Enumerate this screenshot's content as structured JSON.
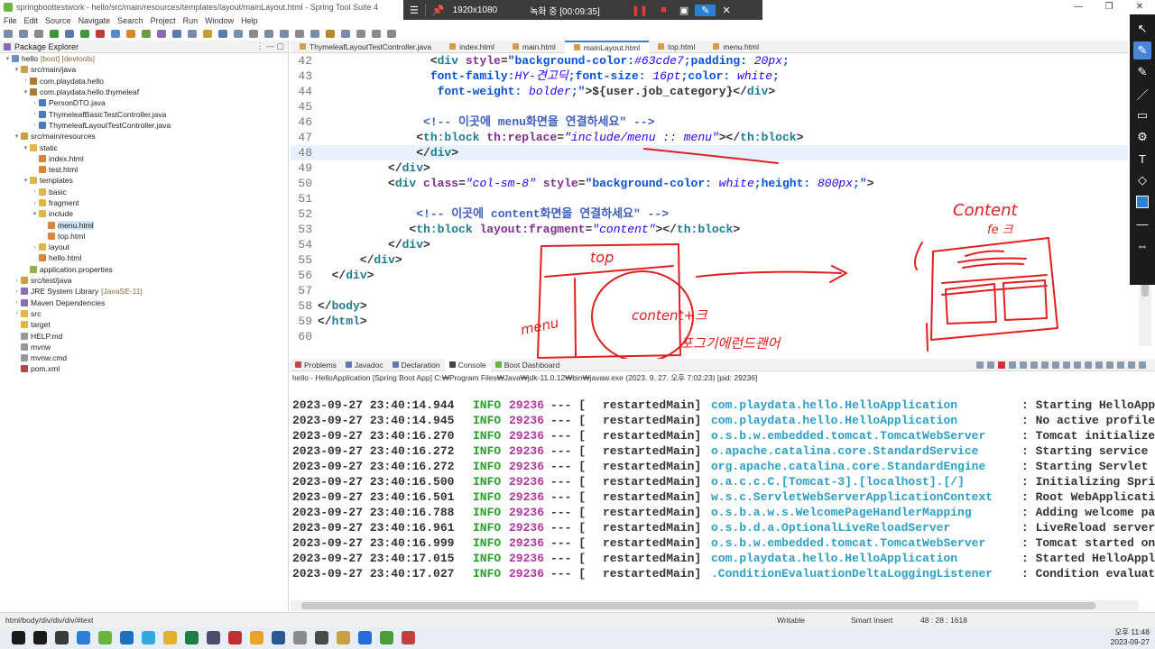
{
  "window": {
    "title": "springboottestwork - hello/src/main/resources/templates/layout/mainLayout.html - Spring Tool Suite 4",
    "controls": [
      "—",
      "❐",
      "✕"
    ]
  },
  "recorder": {
    "resolution": "1920x1080",
    "status": "녹화 중 [00:09:35]"
  },
  "menu": [
    "File",
    "Edit",
    "Source",
    "Navigate",
    "Search",
    "Project",
    "Run",
    "Window",
    "Help"
  ],
  "package_explorer": {
    "title": "Package Explorer",
    "items": [
      {
        "depth": 0,
        "arrow": "▾",
        "label": "hello",
        "decor": "[boot] [devtools]",
        "icon_color": "#6b8fc4",
        "selected": false
      },
      {
        "depth": 1,
        "arrow": "▾",
        "label": "src/main/java",
        "decor": "",
        "icon_color": "#c9a04a",
        "selected": false
      },
      {
        "depth": 2,
        "arrow": "›",
        "label": "com.playdata.hello",
        "decor": "",
        "icon_color": "#a97c2e",
        "selected": false
      },
      {
        "depth": 2,
        "arrow": "▾",
        "label": "com.playdata.hello.thymeleaf",
        "decor": "",
        "icon_color": "#a97c2e",
        "selected": false
      },
      {
        "depth": 3,
        "arrow": "›",
        "label": "PersonDTO.java",
        "decor": "",
        "icon_color": "#4a7bc1",
        "selected": false
      },
      {
        "depth": 3,
        "arrow": "›",
        "label": "ThymeleafBasicTestController.java",
        "decor": "",
        "icon_color": "#4a7bc1",
        "selected": false
      },
      {
        "depth": 3,
        "arrow": "›",
        "label": "ThymeleafLayoutTestController.java",
        "decor": "",
        "icon_color": "#4a7bc1",
        "selected": false
      },
      {
        "depth": 1,
        "arrow": "▾",
        "label": "src/main/resources",
        "decor": "",
        "icon_color": "#c9a04a",
        "selected": false
      },
      {
        "depth": 2,
        "arrow": "▾",
        "label": "static",
        "decor": "",
        "icon_color": "#e0b64a",
        "selected": false
      },
      {
        "depth": 3,
        "arrow": "",
        "label": "index.html",
        "decor": "",
        "icon_color": "#d9863a",
        "selected": false
      },
      {
        "depth": 3,
        "arrow": "",
        "label": "test.html",
        "decor": "",
        "icon_color": "#d9863a",
        "selected": false
      },
      {
        "depth": 2,
        "arrow": "▾",
        "label": "templates",
        "decor": "",
        "icon_color": "#e0b64a",
        "selected": false
      },
      {
        "depth": 3,
        "arrow": "›",
        "label": "basic",
        "decor": "",
        "icon_color": "#e0b64a",
        "selected": false
      },
      {
        "depth": 3,
        "arrow": "›",
        "label": "fragment",
        "decor": "",
        "icon_color": "#e0b64a",
        "selected": false
      },
      {
        "depth": 3,
        "arrow": "▾",
        "label": "include",
        "decor": "",
        "icon_color": "#e0b64a",
        "selected": false
      },
      {
        "depth": 4,
        "arrow": "",
        "label": "menu.html",
        "decor": "",
        "icon_color": "#d9863a",
        "selected": true
      },
      {
        "depth": 4,
        "arrow": "",
        "label": "top.html",
        "decor": "",
        "icon_color": "#d9863a",
        "selected": false
      },
      {
        "depth": 3,
        "arrow": "›",
        "label": "layout",
        "decor": "",
        "icon_color": "#e0b64a",
        "selected": false
      },
      {
        "depth": 3,
        "arrow": "",
        "label": "hello.html",
        "decor": "",
        "icon_color": "#d9863a",
        "selected": false
      },
      {
        "depth": 2,
        "arrow": "",
        "label": "application.properties",
        "decor": "",
        "icon_color": "#8cb54a",
        "selected": false
      },
      {
        "depth": 1,
        "arrow": "›",
        "label": "src/test/java",
        "decor": "",
        "icon_color": "#c9a04a",
        "selected": false
      },
      {
        "depth": 1,
        "arrow": "›",
        "label": "JRE System Library",
        "decor": "[JavaSE-11]",
        "icon_color": "#8b6db3",
        "selected": false
      },
      {
        "depth": 1,
        "arrow": "›",
        "label": "Maven Dependencies",
        "decor": "",
        "icon_color": "#8b6db3",
        "selected": false
      },
      {
        "depth": 1,
        "arrow": "›",
        "label": "src",
        "decor": "",
        "icon_color": "#e0b64a",
        "selected": false
      },
      {
        "depth": 1,
        "arrow": "",
        "label": "target",
        "decor": "",
        "icon_color": "#e0b64a",
        "selected": false
      },
      {
        "depth": 1,
        "arrow": "",
        "label": "HELP.md",
        "decor": "",
        "icon_color": "#999999",
        "selected": false
      },
      {
        "depth": 1,
        "arrow": "",
        "label": "mvnw",
        "decor": "",
        "icon_color": "#999999",
        "selected": false
      },
      {
        "depth": 1,
        "arrow": "",
        "label": "mvnw.cmd",
        "decor": "",
        "icon_color": "#999999",
        "selected": false
      },
      {
        "depth": 1,
        "arrow": "",
        "label": "pom.xml",
        "decor": "",
        "icon_color": "#b04a4a",
        "selected": false
      }
    ]
  },
  "editor_tabs": [
    {
      "label": "ThymeleafLayoutTestController.java",
      "active": false
    },
    {
      "label": "index.html",
      "active": false
    },
    {
      "label": "main.html",
      "active": false
    },
    {
      "label": "mainLayout.html",
      "active": true
    },
    {
      "label": "top.html",
      "active": false
    },
    {
      "label": "menu.html",
      "active": false
    }
  ],
  "code_lines": [
    {
      "n": "42",
      "current": false,
      "parts": [
        [
          "",
          "                <"
        ],
        [
          "tg",
          "div"
        ],
        [
          "",
          " "
        ],
        [
          "at",
          "style"
        ],
        [
          "",
          "="
        ],
        [
          "sk",
          "\"background-color:"
        ],
        [
          "sv",
          "#63cde7"
        ],
        [
          "sk",
          ";padding: "
        ],
        [
          "sv",
          "20px"
        ],
        [
          "sk",
          ";"
        ]
      ]
    },
    {
      "n": "43",
      "current": false,
      "parts": [
        [
          "",
          "                "
        ],
        [
          "sk",
          "font-family:"
        ],
        [
          "sv",
          "HY-견고딕"
        ],
        [
          "sk",
          ";font-size: "
        ],
        [
          "sv",
          "16pt"
        ],
        [
          "sk",
          ";color: "
        ],
        [
          "sv",
          "white"
        ],
        [
          "sk",
          ";"
        ]
      ]
    },
    {
      "n": "44",
      "current": false,
      "parts": [
        [
          "",
          "                 "
        ],
        [
          "sk",
          "font-weight: "
        ],
        [
          "sv",
          "bolder"
        ],
        [
          "sk",
          ";\""
        ],
        [
          "",
          ">${user.job_category}</"
        ],
        [
          "tg",
          "div"
        ],
        [
          "",
          ">"
        ]
      ]
    },
    {
      "n": "45",
      "current": false,
      "parts": []
    },
    {
      "n": "46",
      "current": false,
      "parts": [
        [
          "",
          "               "
        ],
        [
          "cm",
          "<!-- 이곳에 menu화면을 연결하세요\" -->"
        ]
      ]
    },
    {
      "n": "47",
      "current": false,
      "parts": [
        [
          "",
          "              <"
        ],
        [
          "tg",
          "th:block"
        ],
        [
          "",
          " "
        ],
        [
          "at",
          "th:replace"
        ],
        [
          "",
          "="
        ],
        [
          "sv",
          "\"include/menu :: menu\""
        ],
        [
          "",
          "></"
        ],
        [
          "tg",
          "th:block"
        ],
        [
          "",
          ">"
        ]
      ]
    },
    {
      "n": "48",
      "current": true,
      "parts": [
        [
          "",
          "              </"
        ],
        [
          "tg",
          "div"
        ],
        [
          "",
          ">"
        ]
      ]
    },
    {
      "n": "49",
      "current": false,
      "parts": [
        [
          "",
          "          </"
        ],
        [
          "tg",
          "div"
        ],
        [
          "",
          ">"
        ]
      ]
    },
    {
      "n": "50",
      "current": false,
      "parts": [
        [
          "",
          "          <"
        ],
        [
          "tg",
          "div"
        ],
        [
          "",
          " "
        ],
        [
          "at",
          "class"
        ],
        [
          "",
          "="
        ],
        [
          "sv",
          "\"col-sm-8\""
        ],
        [
          "",
          " "
        ],
        [
          "at",
          "style"
        ],
        [
          "",
          "="
        ],
        [
          "sk",
          "\"background-color: "
        ],
        [
          "sv",
          "white"
        ],
        [
          "sk",
          ";height: "
        ],
        [
          "sv",
          "800px"
        ],
        [
          "sk",
          ";\""
        ],
        [
          "",
          ">"
        ]
      ]
    },
    {
      "n": "51",
      "current": false,
      "parts": []
    },
    {
      "n": "52",
      "current": false,
      "parts": [
        [
          "",
          "              "
        ],
        [
          "cm",
          "<!-- 이곳에 content화면을 연결하세요\" -->"
        ]
      ]
    },
    {
      "n": "53",
      "current": false,
      "parts": [
        [
          "",
          "             <"
        ],
        [
          "tg",
          "th:block"
        ],
        [
          "",
          " "
        ],
        [
          "at",
          "layout:fragment"
        ],
        [
          "",
          "="
        ],
        [
          "sv",
          "\"content\""
        ],
        [
          "",
          "></"
        ],
        [
          "tg",
          "th:block"
        ],
        [
          "",
          ">"
        ]
      ]
    },
    {
      "n": "54",
      "current": false,
      "parts": [
        [
          "",
          "          </"
        ],
        [
          "tg",
          "div"
        ],
        [
          "",
          ">"
        ]
      ]
    },
    {
      "n": "55",
      "current": false,
      "parts": [
        [
          "",
          "      </"
        ],
        [
          "tg",
          "div"
        ],
        [
          "",
          ">"
        ]
      ]
    },
    {
      "n": "56",
      "current": false,
      "parts": [
        [
          "",
          "  </"
        ],
        [
          "tg",
          "div"
        ],
        [
          "",
          ">"
        ]
      ]
    },
    {
      "n": "57",
      "current": false,
      "parts": []
    },
    {
      "n": "58",
      "current": false,
      "parts": [
        [
          "",
          "</"
        ],
        [
          "tg",
          "body"
        ],
        [
          "",
          ">"
        ]
      ]
    },
    {
      "n": "59",
      "current": false,
      "parts": [
        [
          "",
          "</"
        ],
        [
          "tg",
          "html"
        ],
        [
          "",
          ">"
        ]
      ]
    },
    {
      "n": "60",
      "current": false,
      "parts": []
    }
  ],
  "annotation_text": {
    "top": "top",
    "content_center": "content+크",
    "menu": "menu",
    "bottom": "포그기에런드괜어",
    "right_top": "Content",
    "right_sub": "fe 크"
  },
  "bottom_tabs": [
    {
      "label": "Problems",
      "active": false,
      "icon_color": "#c04a4a"
    },
    {
      "label": "Javadoc",
      "active": false,
      "icon_color": "#5a7ab0"
    },
    {
      "label": "Declaration",
      "active": false,
      "icon_color": "#5a7ab0"
    },
    {
      "label": "Console",
      "active": true,
      "icon_color": "#444444"
    },
    {
      "label": "Boot Dashboard",
      "active": false,
      "icon_color": "#6db33f"
    }
  ],
  "console_description": "hello - HelloApplication [Spring Boot App] C:₩Program Files₩Java₩jdk-11.0.12₩bin₩javaw.exe  (2023. 9. 27. 오후 7:02:23) [pid: 29236]",
  "console_lines": [
    {
      "ts": "2023-09-27 23:40:14.944",
      "level": "INFO",
      "pid": "29236",
      "sep": "--- [",
      "thread": "restartedMain]",
      "logger": "com.playdata.hello.HelloApplication",
      "msg": ": Starting HelloApp"
    },
    {
      "ts": "2023-09-27 23:40:14.945",
      "level": "INFO",
      "pid": "29236",
      "sep": "--- [",
      "thread": "restartedMain]",
      "logger": "com.playdata.hello.HelloApplication",
      "msg": ": No active profile"
    },
    {
      "ts": "2023-09-27 23:40:16.270",
      "level": "INFO",
      "pid": "29236",
      "sep": "--- [",
      "thread": "restartedMain]",
      "logger": "o.s.b.w.embedded.tomcat.TomcatWebServer",
      "msg": ": Tomcat initialize"
    },
    {
      "ts": "2023-09-27 23:40:16.272",
      "level": "INFO",
      "pid": "29236",
      "sep": "--- [",
      "thread": "restartedMain]",
      "logger": "o.apache.catalina.core.StandardService",
      "msg": ": Starting service"
    },
    {
      "ts": "2023-09-27 23:40:16.272",
      "level": "INFO",
      "pid": "29236",
      "sep": "--- [",
      "thread": "restartedMain]",
      "logger": "org.apache.catalina.core.StandardEngine",
      "msg": ": Starting Servlet"
    },
    {
      "ts": "2023-09-27 23:40:16.500",
      "level": "INFO",
      "pid": "29236",
      "sep": "--- [",
      "thread": "restartedMain]",
      "logger": "o.a.c.c.C.[Tomcat-3].[localhost].[/]",
      "msg": ": Initializing Spri"
    },
    {
      "ts": "2023-09-27 23:40:16.501",
      "level": "INFO",
      "pid": "29236",
      "sep": "--- [",
      "thread": "restartedMain]",
      "logger": "w.s.c.ServletWebServerApplicationContext",
      "msg": ": Root WebApplicati"
    },
    {
      "ts": "2023-09-27 23:40:16.788",
      "level": "INFO",
      "pid": "29236",
      "sep": "--- [",
      "thread": "restartedMain]",
      "logger": "o.s.b.a.w.s.WelcomePageHandlerMapping",
      "msg": ": Adding welcome pa"
    },
    {
      "ts": "2023-09-27 23:40:16.961",
      "level": "INFO",
      "pid": "29236",
      "sep": "--- [",
      "thread": "restartedMain]",
      "logger": "o.s.b.d.a.OptionalLiveReloadServer",
      "msg": ": LiveReload server"
    },
    {
      "ts": "2023-09-27 23:40:16.999",
      "level": "INFO",
      "pid": "29236",
      "sep": "--- [",
      "thread": "restartedMain]",
      "logger": "o.s.b.w.embedded.tomcat.TomcatWebServer",
      "msg": ": Tomcat started on"
    },
    {
      "ts": "2023-09-27 23:40:17.015",
      "level": "INFO",
      "pid": "29236",
      "sep": "--- [",
      "thread": "restartedMain]",
      "logger": "com.playdata.hello.HelloApplication",
      "msg": ": Started HelloAppl"
    },
    {
      "ts": "2023-09-27 23:40:17.027",
      "level": "INFO",
      "pid": "29236",
      "sep": "--- [",
      "thread": "restartedMain]",
      "logger": ".ConditionEvaluationDeltaLoggingListener",
      "msg": ": Condition evaluat"
    }
  ],
  "status_bar": {
    "path": "html/body/div/div/div/#text",
    "mode": "Writable",
    "insert": "Smart Insert",
    "position": "48 : 28 : 1618"
  },
  "taskbar": {
    "apps": [
      "#1a1a1a",
      "#1a1a1a",
      "#3a3a3a",
      "#2d7fd6",
      "#6db33f",
      "#1f6fbf",
      "#31a8e0",
      "#e0b12a",
      "#1e7d45",
      "#4d4d6b",
      "#c03030",
      "#e8a42a",
      "#2b5797",
      "#8a8a8a",
      "#4a4a4a",
      "#c9a13a",
      "#2b68d8",
      "#4a9d3a",
      "#c04040"
    ],
    "time": "오후 11:48",
    "date": "2023-09-27"
  },
  "draw_tools": [
    "↖",
    "✎",
    "✎",
    "／",
    "▭",
    "⚙",
    "T",
    "◇",
    "■",
    "—",
    "⇔"
  ]
}
